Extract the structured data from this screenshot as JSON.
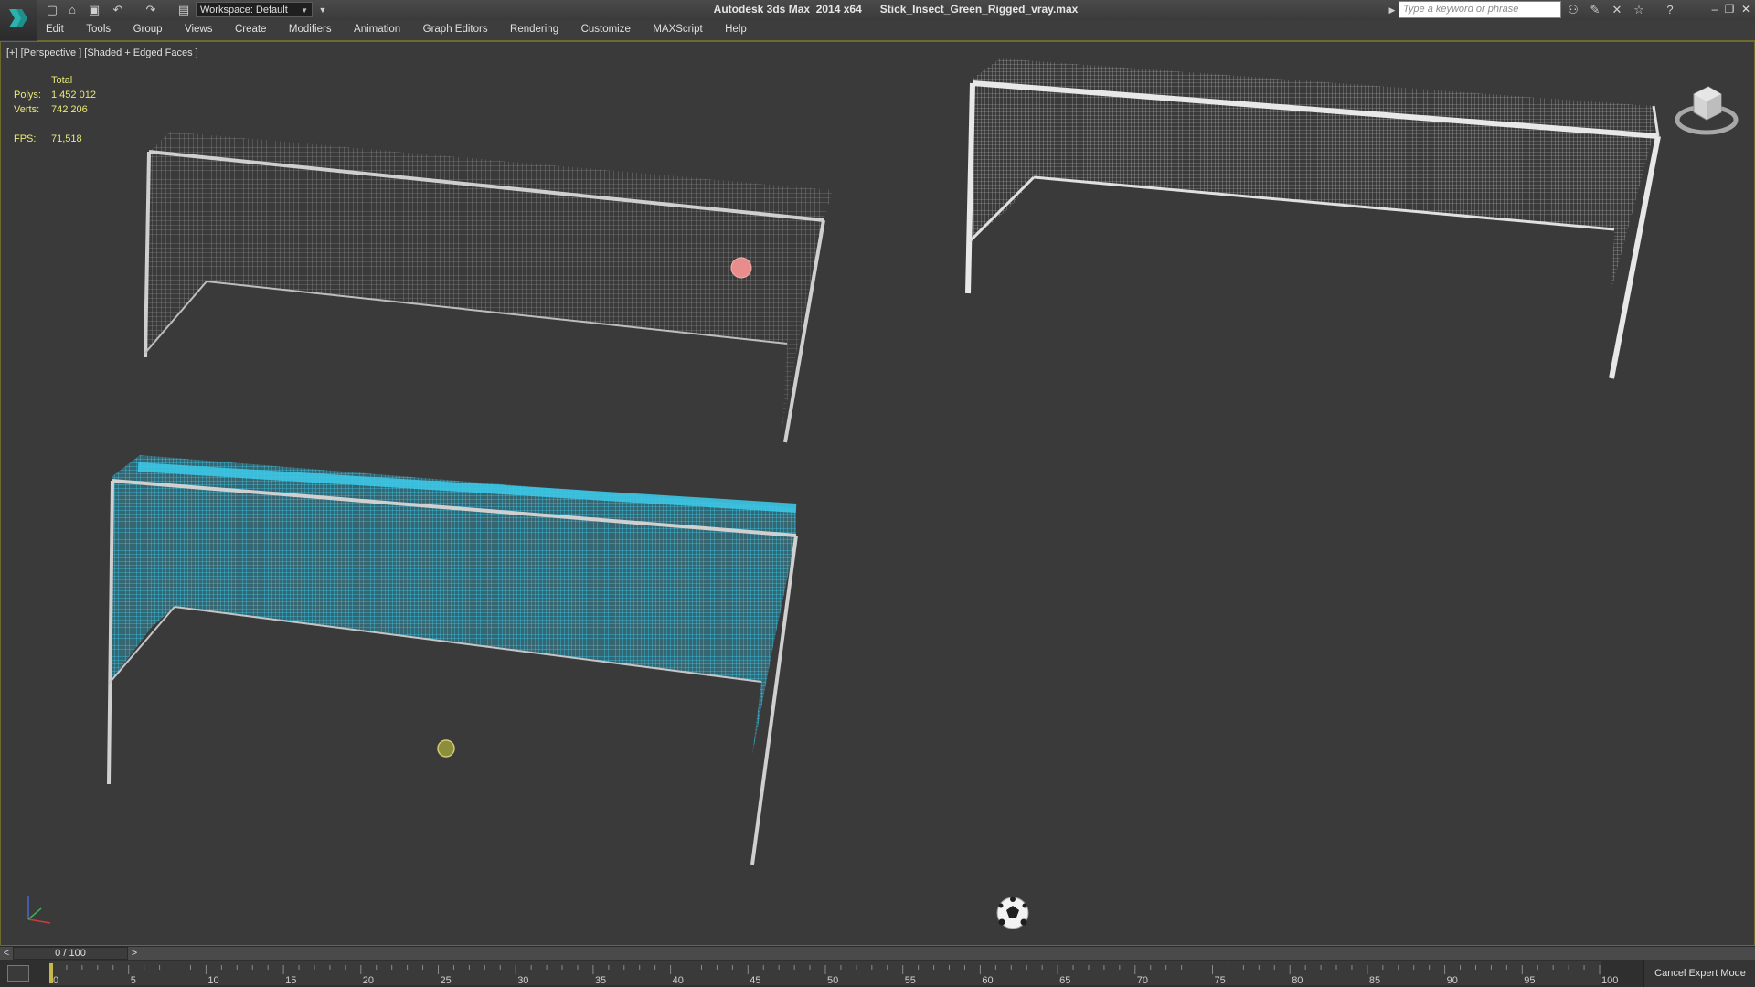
{
  "titlebar": {
    "title": "Autodesk 3ds Max  2014 x64      Stick_Insect_Green_Rigged_vray.max",
    "workspace": "Workspace: Default",
    "search_placeholder": "Type a keyword or phrase"
  },
  "menu": [
    "Edit",
    "Tools",
    "Group",
    "Views",
    "Create",
    "Modifiers",
    "Animation",
    "Graph Editors",
    "Rendering",
    "Customize",
    "MAXScript",
    "Help"
  ],
  "viewport": {
    "label": "[+] [Perspective ] [Shaded + Edged Faces ]",
    "stats": {
      "header": "Total",
      "polys_label": "Polys:",
      "polys_value": "1 452 012",
      "verts_label": "Verts:",
      "verts_value": "742 206",
      "fps_label": "FPS:",
      "fps_value": "71,518"
    },
    "colors": {
      "background": "#3a3a3a",
      "net_wire": "#bfbfbf",
      "selected_net": "#2fb6d6",
      "stats_text": "#e8e87a"
    }
  },
  "timeline": {
    "frame_display": "0 / 100",
    "prev": "<",
    "next": ">",
    "ticks": [
      "0",
      "5",
      "10",
      "15",
      "20",
      "25",
      "30",
      "35",
      "40",
      "45",
      "50",
      "55",
      "60",
      "65",
      "70",
      "75",
      "80",
      "85",
      "90",
      "95",
      "100"
    ]
  },
  "statusbar": {
    "cancel_expert_mode": "Cancel Expert Mode"
  }
}
